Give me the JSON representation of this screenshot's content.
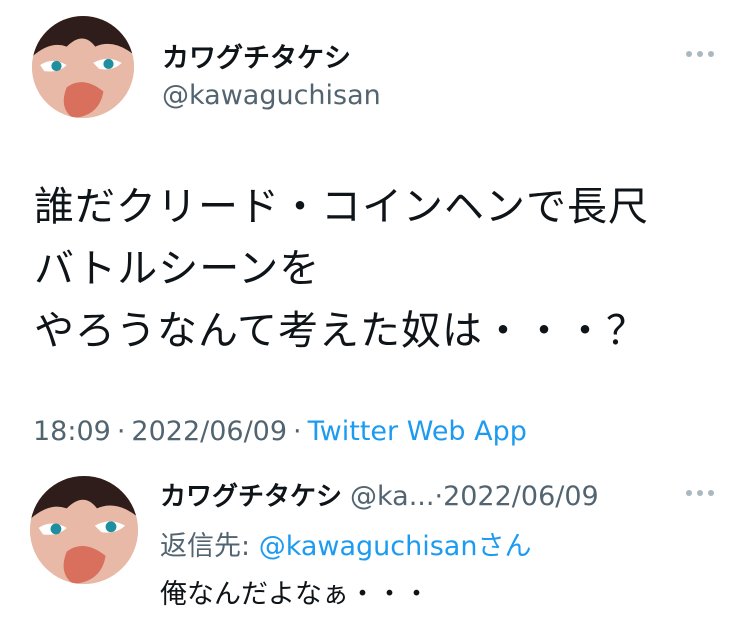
{
  "tweet": {
    "display_name": "カワグチタケシ",
    "handle": "@kawaguchisan",
    "text_lines": [
      "誰だクリード・コインヘンで長尺",
      "バトルシーンを",
      "やろうなんて考えた奴は・・・？"
    ],
    "time": "18:09",
    "dot1": "·",
    "date": "2022/06/09",
    "dot2": "·",
    "source": "Twitter Web App"
  },
  "reply": {
    "display_name": "カワグチタケシ",
    "handle_truncated": "@ka...",
    "dot": "·",
    "date": "2022/06/09",
    "reply_to_label": "返信先: ",
    "reply_to_handle": "@kawaguchisan",
    "reply_to_suffix": "さん",
    "text": "俺なんだよなぁ・・・"
  },
  "colors": {
    "text": "#0f1419",
    "secondary": "#536471",
    "link": "#1d9bf0"
  },
  "icons": {
    "more": "more-horizontal-icon",
    "avatar": "user-avatar"
  }
}
